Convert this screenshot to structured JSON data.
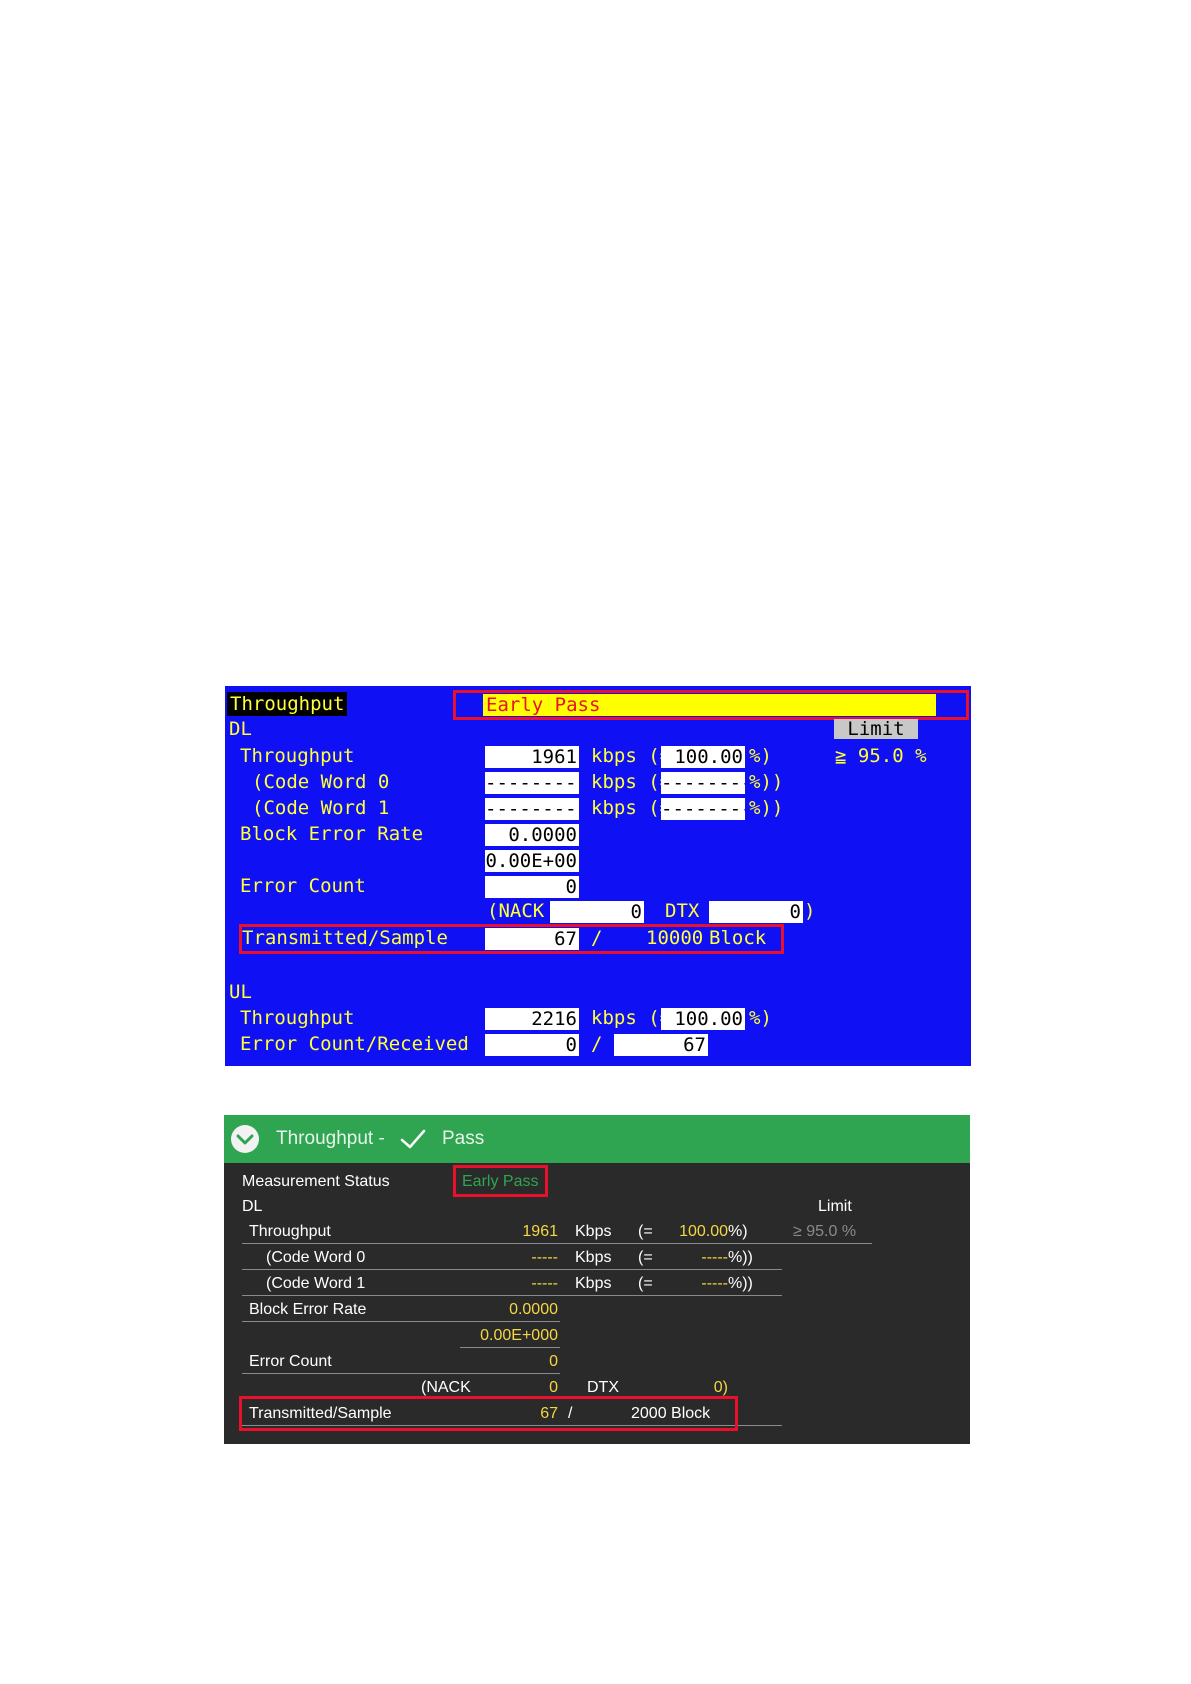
{
  "colors": {
    "legacy_bg": "#1010f4",
    "legacy_text": "#ffff3a",
    "status_bar": "#ffff00",
    "highlight_red": "#e8102a",
    "modern_bg": "#2a2a2a",
    "modern_header": "#2fa551",
    "modern_value": "#f5d742",
    "modern_status": "#2fa551"
  },
  "legacy": {
    "title": "Throughput",
    "status": "Early Pass",
    "dl_label": "DL",
    "limit_button": "Limit",
    "limit_value": "≧ 95.0 %",
    "rows": {
      "throughput": {
        "label": "Throughput",
        "value": "1961",
        "unit": "kbps (=",
        "percent": "100.00",
        "close": "%)"
      },
      "cw0": {
        "label": "(Code Word 0",
        "value": "----------",
        "unit": "kbps (=",
        "percent": "---------",
        "close": "%))"
      },
      "cw1": {
        "label": "(Code Word 1",
        "value": "----------",
        "unit": "kbps (=",
        "percent": "---------",
        "close": "%))"
      },
      "bler": {
        "label": "Block Error Rate",
        "value": "0.0000",
        "value2": "0.00E+00"
      },
      "error_count": {
        "label": "Error Count",
        "value": "0"
      },
      "nack": {
        "label": "(NACK",
        "value": "0",
        "dtx_label": "DTX",
        "dtx_value": "0",
        "close": ")"
      },
      "transmitted": {
        "label": "Transmitted/Sample",
        "value": "67",
        "sep": "/",
        "sample": "10000",
        "unit": "Block"
      }
    },
    "ul_label": "UL",
    "ul_rows": {
      "throughput": {
        "label": "Throughput",
        "value": "2216",
        "unit": "kbps (=",
        "percent": "100.00",
        "close": "%)"
      },
      "error_received": {
        "label": "Error Count/Received",
        "value": "0",
        "sep": "/",
        "received": "67"
      }
    }
  },
  "modern": {
    "title": "Throughput -",
    "result": "Pass",
    "measurement_status_label": "Measurement Status",
    "measurement_status_value": "Early Pass",
    "dl_label": "DL",
    "limit_label": "Limit",
    "rows": {
      "throughput": {
        "label": "Throughput",
        "value": "1961",
        "unit": "Kbps",
        "open": "(=",
        "percent": "100.00",
        "close": "%)",
        "limit": "≥ 95.0 %"
      },
      "cw0": {
        "label": "(Code Word 0",
        "value": "-----",
        "unit": "Kbps",
        "open": "(=",
        "percent": "-----",
        "close": "%))"
      },
      "cw1": {
        "label": "(Code Word 1",
        "value": "-----",
        "unit": "Kbps",
        "open": "(=",
        "percent": "-----",
        "close": "%))"
      },
      "bler": {
        "label": "Block Error Rate",
        "value": "0.0000",
        "value2": "0.00E+000"
      },
      "error_count": {
        "label": "Error Count",
        "value": "0"
      },
      "nack": {
        "label": "(NACK",
        "value": "0",
        "dtx_label": "DTX",
        "dtx_value": "0)"
      },
      "transmitted": {
        "label": "Transmitted/Sample",
        "value": "67",
        "sep": "/",
        "sample": "2000 Block"
      }
    }
  }
}
